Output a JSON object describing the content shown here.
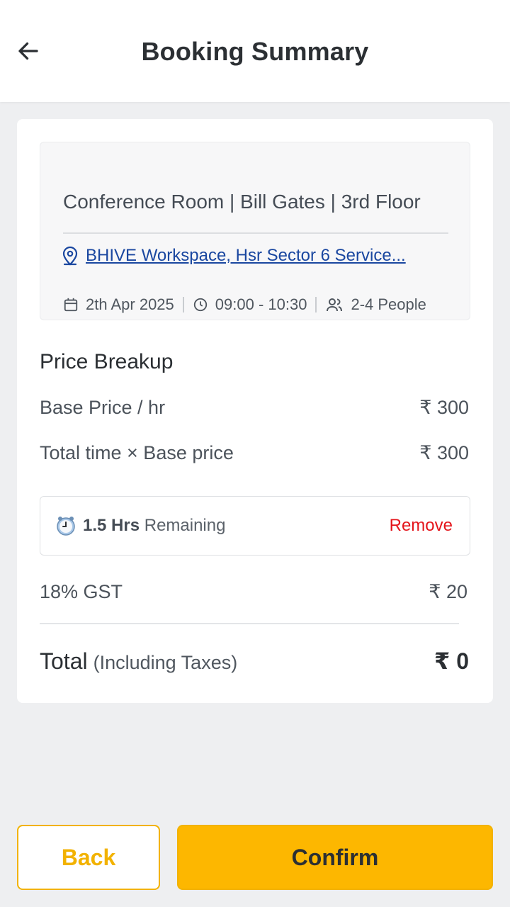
{
  "header": {
    "title": "Booking Summary",
    "back_icon": "arrow-left-icon"
  },
  "room": {
    "name": "Conference Room | Bill Gates | 3rd Floor",
    "location_icon": "map-pin-icon",
    "location": "BHIVE Workspace, Hsr Sector 6 Service...",
    "date_icon": "calendar-icon",
    "date": "2th Apr 2025",
    "time_icon": "clock-icon",
    "time": "09:00 - 10:30",
    "people_icon": "people-icon",
    "people": "2-4 People"
  },
  "price": {
    "section_title": "Price Breakup",
    "rows": [
      {
        "label": "Base Price / hr",
        "value": "₹ 300"
      },
      {
        "label": "Total time × Base price",
        "value": "₹ 300"
      }
    ],
    "remaining": {
      "icon": "clock-emoji-icon",
      "hours": "1.5 Hrs",
      "text": "Remaining",
      "remove_label": "Remove"
    },
    "gst": {
      "label": "18% GST",
      "value": "₹ 20"
    },
    "total": {
      "label": "Total",
      "sub": "(Including Taxes)",
      "value": "₹ 0"
    }
  },
  "footer": {
    "back_label": "Back",
    "confirm_label": "Confirm"
  },
  "colors": {
    "accent": "#fdb700",
    "link": "#1a47a0",
    "danger": "#e4151b"
  }
}
